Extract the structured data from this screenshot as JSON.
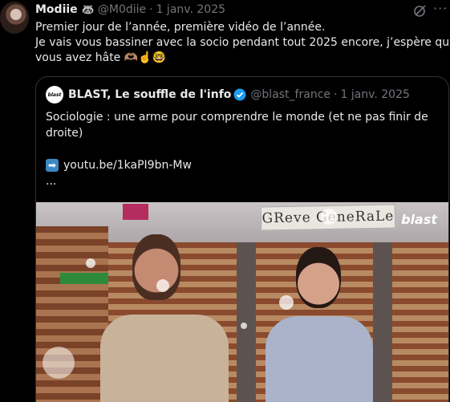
{
  "tweet": {
    "author_name": "Modiie",
    "author_emoji": "🦝",
    "handle": "@M0diie",
    "separator": "·",
    "date": "1 janv. 2025",
    "lines": [
      "Premier jour de l’année, première vidéo de l’année.",
      "Je vais vous bassiner avec la socio pendant tout 2025 encore, j’espère que",
      "vous avez hâte 🫶🏽☝️🤓"
    ]
  },
  "quote": {
    "logo_text": "blast",
    "author_name": "BLAST, Le souffle de l'info",
    "handle": "@blast_france",
    "separator": "·",
    "date": "1 janv. 2025",
    "text_line1": "Sociologie : une arme pour comprendre le monde (et ne pas finir de",
    "text_line2": "droite)",
    "link_icon": "➡",
    "link": "youtu.be/1kaPI9bn-Mw",
    "ellipsis": "...",
    "media": {
      "banner_text": "GReve GeneRaLe",
      "brand": "blast",
      "progress": 0.01
    }
  },
  "icons": {
    "grok": "grok-icon",
    "more": "more-icon",
    "verified_color": "#1d9bf0"
  }
}
